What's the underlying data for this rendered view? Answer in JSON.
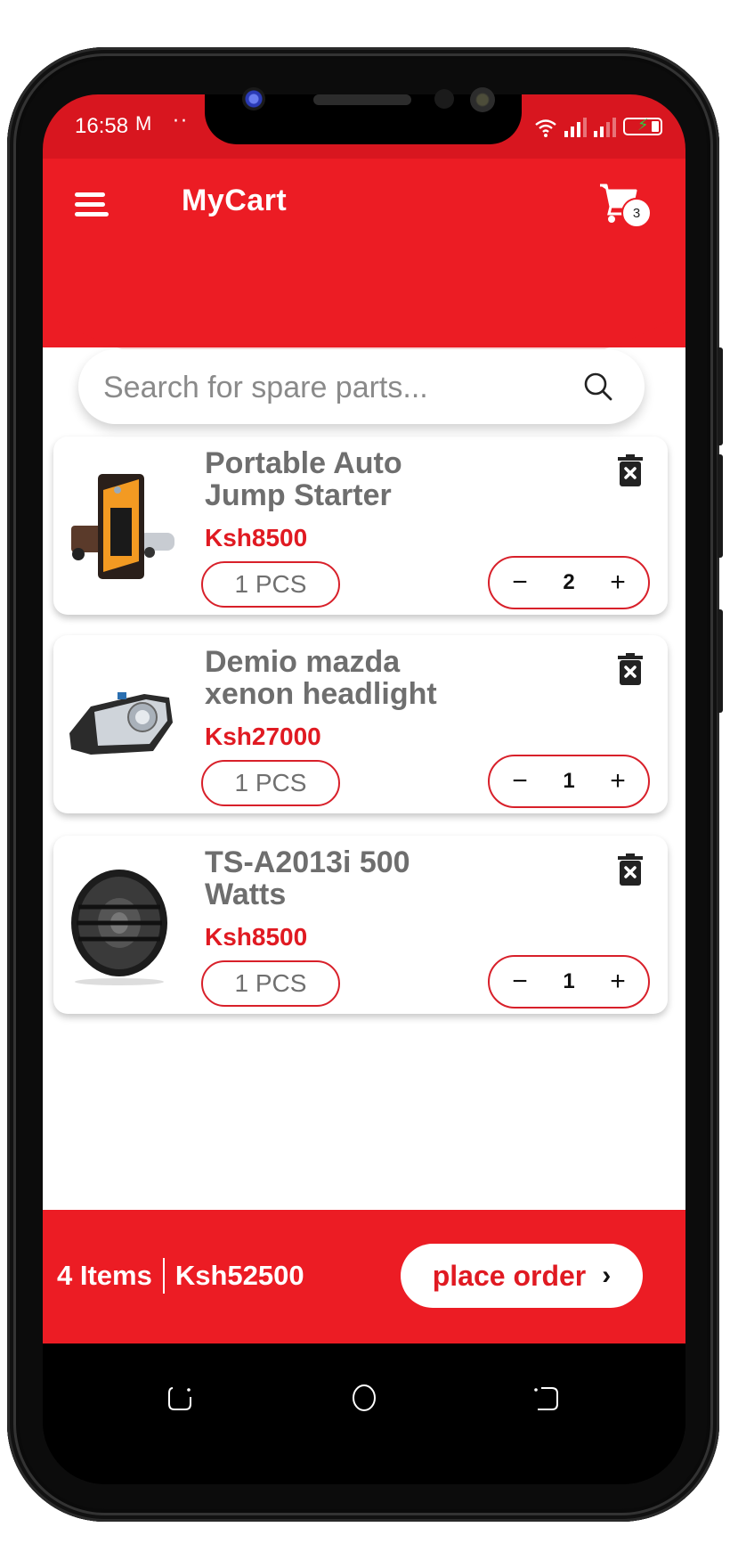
{
  "status_bar": {
    "time": "16:58",
    "notification_icons": [
      "gmail-icon",
      "more-dots-icon"
    ],
    "mail_glyph": "M",
    "dots": "··",
    "right_icons": [
      "wifi-icon",
      "signal-sim1-icon",
      "signal-sim2-icon",
      "battery-charging-icon"
    ]
  },
  "header": {
    "title": "MyCart",
    "menu_icon": "hamburger-menu-icon",
    "cart_icon": "shopping-cart-icon",
    "cart_badge": "3",
    "brand_color": "#ec1c24"
  },
  "search": {
    "placeholder": "Search for spare parts...",
    "value": "",
    "icon": "search-icon"
  },
  "cart_items": [
    {
      "name": "Portable Auto Jump Starter",
      "price": "Ksh8500",
      "unit": "1 PCS",
      "quantity": "2",
      "image": "jump-starter-image"
    },
    {
      "name": "Demio mazda xenon headlight",
      "price": "Ksh27000",
      "unit": "1 PCS",
      "quantity": "1",
      "image": "headlight-image"
    },
    {
      "name": "TS-A2013i 500 Watts",
      "price": "Ksh8500",
      "unit": "1 PCS",
      "quantity": "1",
      "image": "speaker-image"
    }
  ],
  "stepper": {
    "decrement": "−",
    "increment": "+"
  },
  "footer": {
    "items_count": "4 Items",
    "total": "Ksh52500",
    "place_order_label": "place order",
    "chevron": "›"
  },
  "nav": {
    "buttons": [
      "recent-apps",
      "home",
      "back"
    ]
  },
  "colors": {
    "primary_red": "#ec1c24",
    "price_red": "#e01a22",
    "text_gray": "#6e6e6e"
  }
}
